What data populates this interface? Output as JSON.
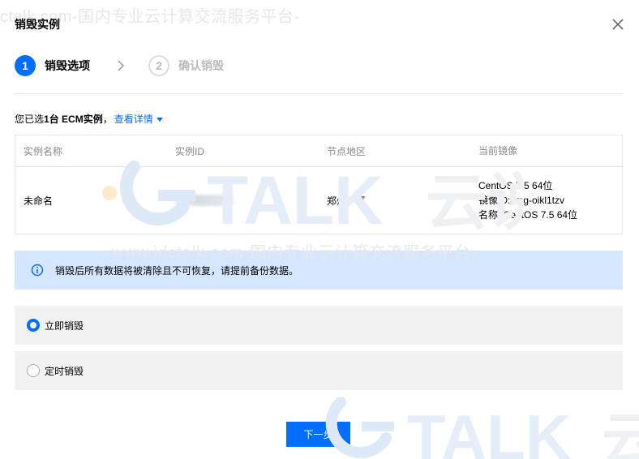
{
  "watermark": {
    "top_text": "ctalk.com-国内专业云计算交流服务平台-",
    "mid_text": "-www.idctalk.com-国内专业云计算交流服务平台-",
    "logo_text": "TALK",
    "logo_cn": "云说"
  },
  "dialog": {
    "title": "销毁实例"
  },
  "steps": [
    {
      "number": "1",
      "label": "销毁选项"
    },
    {
      "number": "2",
      "label": "确认销毁"
    }
  ],
  "summary": {
    "prefix": "您已选",
    "count": "1台 ECM实例",
    "comma": "，",
    "link": "查看详情"
  },
  "table": {
    "headers": [
      "实例名称",
      "实例ID",
      "节点地区",
      "当前镜像"
    ],
    "rows": [
      {
        "name": "未命名",
        "region": "郑州一区",
        "image_lines": [
          "CentOS 7.5 64位",
          "镜像ID: img-oikl1tzv",
          "名称: CentOS 7.5 64位"
        ]
      }
    ]
  },
  "alert": {
    "text": "销毁后所有数据将被清除且不可恢复，请提前备份数据。"
  },
  "options": [
    {
      "label": "立即销毁",
      "checked": true
    },
    {
      "label": "定时销毁",
      "checked": false
    }
  ],
  "footer": {
    "next_label": "下一步"
  },
  "colors": {
    "primary": "#006eff",
    "alert_bg": "#d5e7ff",
    "option_bg": "#f2f2f2"
  }
}
